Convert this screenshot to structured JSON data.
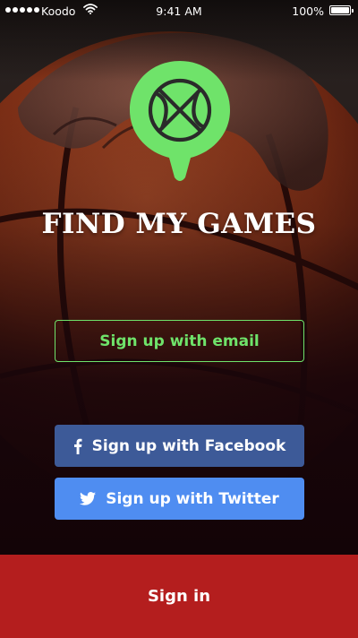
{
  "status_bar": {
    "carrier": "Koodo",
    "time": "9:41 AM",
    "battery": "100%"
  },
  "app": {
    "title": "FIND MY GAMES",
    "logo_icon": "basketball-map-pin-icon",
    "brand_green": "#6fe36a"
  },
  "buttons": {
    "email": "Sign up with email",
    "facebook": "Sign up with Facebook",
    "twitter": "Sign up with Twitter",
    "signin": "Sign in"
  },
  "colors": {
    "facebook": "#3d5a98",
    "twitter": "#4f8df1",
    "signin": "#b41e1e",
    "background": "#120608"
  },
  "icons": {
    "facebook": "facebook-icon",
    "twitter": "twitter-icon"
  }
}
